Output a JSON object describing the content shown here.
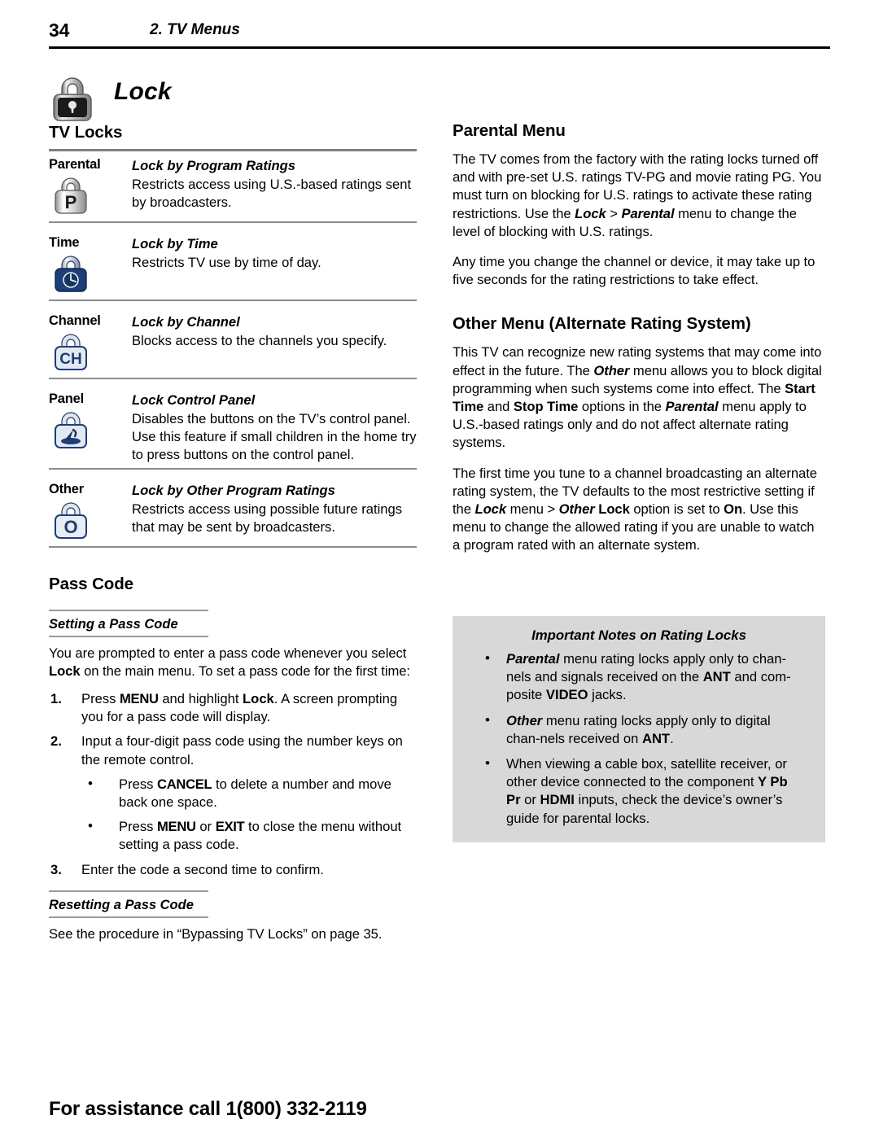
{
  "header": {
    "page_number": "34",
    "chapter": "2.  TV Menus"
  },
  "lock_title": {
    "text": "Lock",
    "icon": "padlock-icon"
  },
  "left_column": {
    "tv_locks_heading": "TV Locks",
    "rows": [
      {
        "label": "Parental",
        "icon": "padlock-p-icon",
        "title": "Lock by Program Ratings",
        "body": "Restricts access using U.S.-based ratings sent by broadcasters."
      },
      {
        "label": "Time",
        "icon": "padlock-clock-icon",
        "title": "Lock by Time",
        "body": "Restricts TV use by time of day."
      },
      {
        "label": "Channel",
        "icon": "padlock-ch-icon",
        "title": "Lock by Channel",
        "body": "Blocks access to the channels you specify."
      },
      {
        "label": "Panel",
        "icon": "padlock-hand-icon",
        "title": "Lock Control Panel",
        "body": "Disables the buttons on the TV’s control panel.  Use this feature if small children in the home try to press buttons on the control panel."
      },
      {
        "label": "Other",
        "icon": "padlock-o-icon",
        "title": "Lock by Other Program Ratings",
        "body": "Restricts access using possible future ratings that may be sent by broadcasters."
      }
    ],
    "pass_code_heading": "Pass Code",
    "setting_sub_heading": "Setting a Pass Code",
    "setting_intro_parts": {
      "a": "You are prompted to enter a pass code whenever you select ",
      "b": "Lock",
      "c": " on the main menu.  To set a pass code for the first time:"
    },
    "steps": [
      {
        "num": "1.",
        "parts": {
          "a": "Press ",
          "b": "MENU",
          "c": " and highlight ",
          "d": "Lock",
          "e": ".  A screen prompting you for a pass code will display."
        }
      },
      {
        "num": "2.",
        "parts": {
          "a": "Input a four-digit pass code using the number keys on the remote control.",
          "b": "",
          "c": "",
          "d": "",
          "e": ""
        }
      },
      {
        "num": "3.",
        "parts": {
          "a": "Enter the code a second time to confirm.",
          "b": "",
          "c": "",
          "d": "",
          "e": ""
        }
      }
    ],
    "sub_bullets": [
      {
        "a": "Press ",
        "b": "CANCEL",
        "c": " to delete a number and move back one space.",
        "d": "",
        "e": ""
      },
      {
        "a": "Press ",
        "b": "MENU",
        "c": " or ",
        "d": "EXIT",
        "e": " to close the menu without setting a pass code."
      }
    ],
    "resetting_sub_heading": "Resetting a Pass Code",
    "resetting_body": "See the procedure in “Bypassing TV Locks” on page 35."
  },
  "right_column": {
    "parental_heading": "Parental Menu",
    "parental_p1": {
      "a": "The TV comes from the factory with the rating locks turned off and with pre-set U.S. ratings TV-PG and movie rating PG.  You must turn on blocking for U.S. ratings to activate these rating restrictions.  Use the ",
      "b": "Lock",
      "c": " > ",
      "d": "Parental",
      "e": " menu to change the level of blocking with U.S. ratings."
    },
    "parental_p2": "Any time you change the channel or device, it may take up to five seconds for the rating restrictions to take effect.",
    "other_heading": "Other Menu (Alternate Rating System)",
    "other_p1": {
      "a": "This TV can recognize new rating systems that may come into effect in the future.  The ",
      "b": "Other",
      "c": " menu allows you to block digital programming when such systems come into effect.  The ",
      "d": "Start Time",
      "e": " and ",
      "f": "Stop Time",
      "g": " options in the ",
      "h": "Parental",
      "i": " menu apply to U.S.-based ratings only and do not affect alternate rating systems."
    },
    "other_p2": {
      "a": "The first time you tune to a channel broadcasting an alternate rating system, the TV defaults to the most restrictive setting if the ",
      "b": "Lock",
      "c": " menu > ",
      "d": "Other",
      "e": " ",
      "f": "Lock",
      "g": " option is set to ",
      "h": "On",
      "i": ".  Use this menu to change the allowed rating if you are unable to watch a program rated with an alternate system."
    },
    "notes": {
      "title": "Important Notes on Rating Locks",
      "items": [
        {
          "a": "Parental",
          "b": " menu rating locks apply only to chan-nels and signals received on the ",
          "c": "ANT",
          "d": " and com-posite ",
          "e": "VIDEO",
          "f": " jacks."
        },
        {
          "a": "Other",
          "b": " menu rating locks apply only to digital chan-nels received on ",
          "c": "ANT",
          "d": ".",
          "e": "",
          "f": ""
        },
        {
          "a": "",
          "b": "When viewing a cable box, satellite receiver, or other device connected to the component ",
          "c": "Y Pb Pr",
          "d": " or ",
          "e": "HDMI",
          "f": " inputs, check the device’s owner’s guide for parental locks."
        }
      ]
    }
  },
  "footer": {
    "text": "For assistance call 1(800) 332-2119"
  },
  "colors": {
    "rule_dark": "#000000",
    "rule_gray": "#8c8c8c",
    "notes_background": "#d8d8d8",
    "icon_blue": "#1b3a6b",
    "icon_gray": "#c9c9c9"
  }
}
